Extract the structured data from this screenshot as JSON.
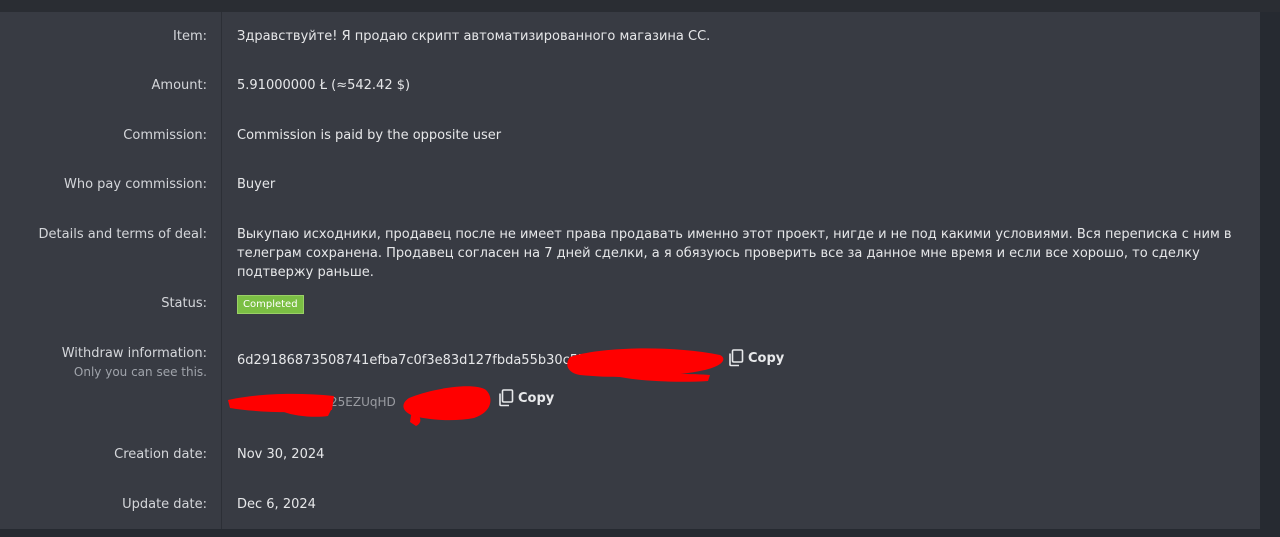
{
  "details": {
    "item_label": "Item:",
    "item_value": "Здравствуйте! Я продаю скрипт автоматизированного магазина CC.",
    "amount_label": "Amount:",
    "amount_value": "5.91000000 Ł (≈542.42 $)",
    "commission_label": "Commission:",
    "commission_value": "Commission is paid by the opposite user",
    "who_pay_label": "Who pay commission:",
    "who_pay_value": "Buyer",
    "terms_label": "Details and terms of deal:",
    "terms_value": "Выкупаю исходники, продавец после не имеет права продавать именно этот проект, нигде и не под какими условиями. Вся переписка с ним в телеграм сохранена. Продавец согласен на 7 дней сделки, а я обязуюсь проверить все за данное мне время и если все хорошо, то сделку подтвержу раньше.",
    "status_label": "Status:",
    "status_value": "Completed",
    "withdraw_label": "Withdraw information:",
    "withdraw_sublabel": "Only you can see this.",
    "withdraw_hash": "6d29186873508741efba7c0f3e83d127fbda55b30c57",
    "withdraw_address_visible": "25EZUqHD",
    "copy_label": "Copy",
    "creation_label": "Creation date:",
    "creation_value": "Nov 30, 2024",
    "update_label": "Update date:",
    "update_value": "Dec 6, 2024"
  },
  "colors": {
    "status_badge": "#7bbf44",
    "redaction": "#ff0000"
  },
  "icons": {
    "copy": "copy-icon"
  }
}
